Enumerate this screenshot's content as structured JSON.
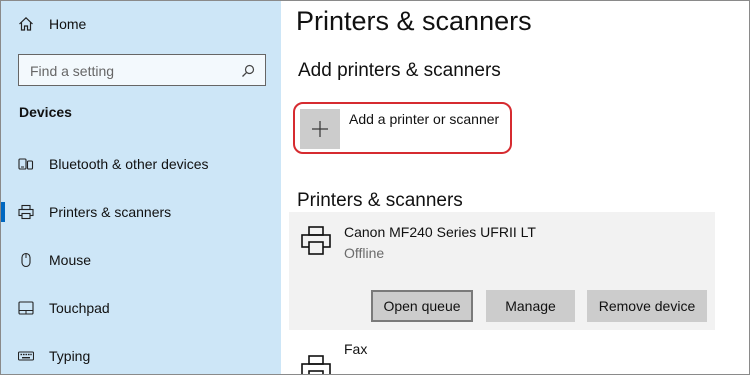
{
  "sidebar": {
    "home_label": "Home",
    "search": {
      "placeholder": "Find a setting",
      "icon": "search-icon"
    },
    "section_label": "Devices",
    "items": [
      {
        "label": "Bluetooth & other devices",
        "icon": "bluetooth-devices-icon"
      },
      {
        "label": "Printers & scanners",
        "icon": "printer-icon",
        "active": true
      },
      {
        "label": "Mouse",
        "icon": "mouse-icon"
      },
      {
        "label": "Touchpad",
        "icon": "touchpad-icon"
      },
      {
        "label": "Typing",
        "icon": "keyboard-icon"
      }
    ]
  },
  "main": {
    "title": "Printers & scanners",
    "add_section_title": "Add printers & scanners",
    "add_button_label": "Add a printer or scanner",
    "list_section_title": "Printers & scanners",
    "printers": [
      {
        "name": "Canon MF240 Series UFRII LT",
        "status": "Offline",
        "buttons": {
          "open_queue": "Open queue",
          "manage": "Manage",
          "remove": "Remove device"
        }
      },
      {
        "name": "Fax"
      }
    ]
  },
  "colors": {
    "sidebar_bg": "#cde6f7",
    "accent": "#0067c0",
    "highlight_outline": "#d62b30",
    "card_bg": "#f2f2f2",
    "button_bg": "#cccccc"
  }
}
